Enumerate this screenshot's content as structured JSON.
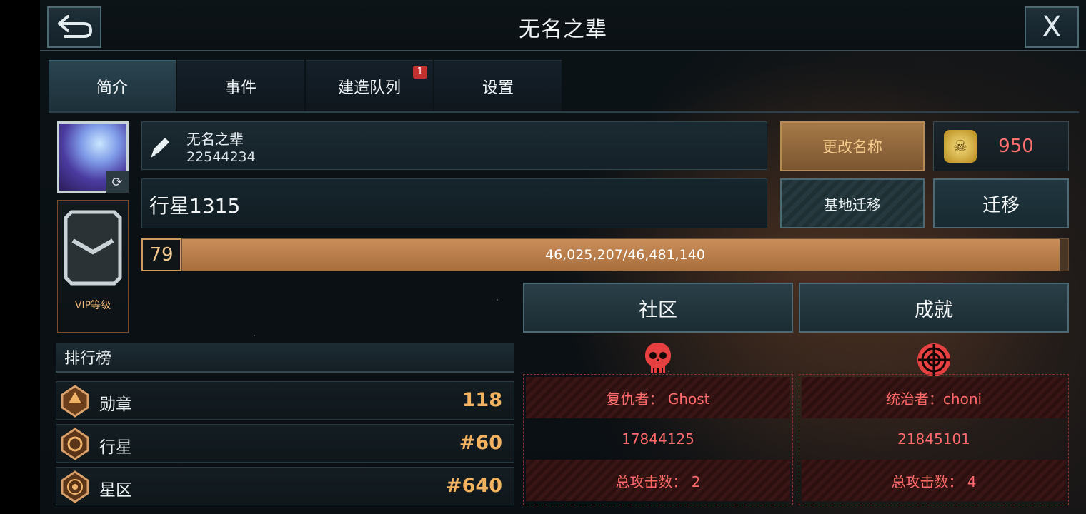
{
  "header": {
    "title": "无名之辈",
    "close_label": "X"
  },
  "tabs": [
    {
      "label": "简介",
      "active": true
    },
    {
      "label": "事件"
    },
    {
      "label": "建造队列",
      "badge": "1"
    },
    {
      "label": "设置"
    }
  ],
  "profile": {
    "name": "无名之辈",
    "uid": "22544234",
    "planet": "行星1315",
    "vip_label": "VIP等级",
    "rename_label": "更改名称",
    "coins": "950",
    "relocate_base_label": "基地迁移",
    "migrate_label": "迁移"
  },
  "experience": {
    "level": "79",
    "text": "46,025,207/46,481,140",
    "progress": 0.9902
  },
  "buttons": {
    "community": "社区",
    "achievements": "成就"
  },
  "ranking": {
    "title": "排行榜",
    "rows": [
      {
        "label": "勋章",
        "value": "118"
      },
      {
        "label": "行星",
        "value": "#60"
      },
      {
        "label": "星区",
        "value": "#640"
      }
    ]
  },
  "avenger": {
    "title": "复仇者： Ghost",
    "score": "17844125",
    "attacks": "总攻击数： 2"
  },
  "ruler": {
    "title": "统治者：choni",
    "score": "21845101",
    "attacks": "总攻击数： 4"
  },
  "colors": {
    "accent_orange": "#c98e5a",
    "red_text": "#ff6b6b",
    "gold": "#f2b25f"
  }
}
